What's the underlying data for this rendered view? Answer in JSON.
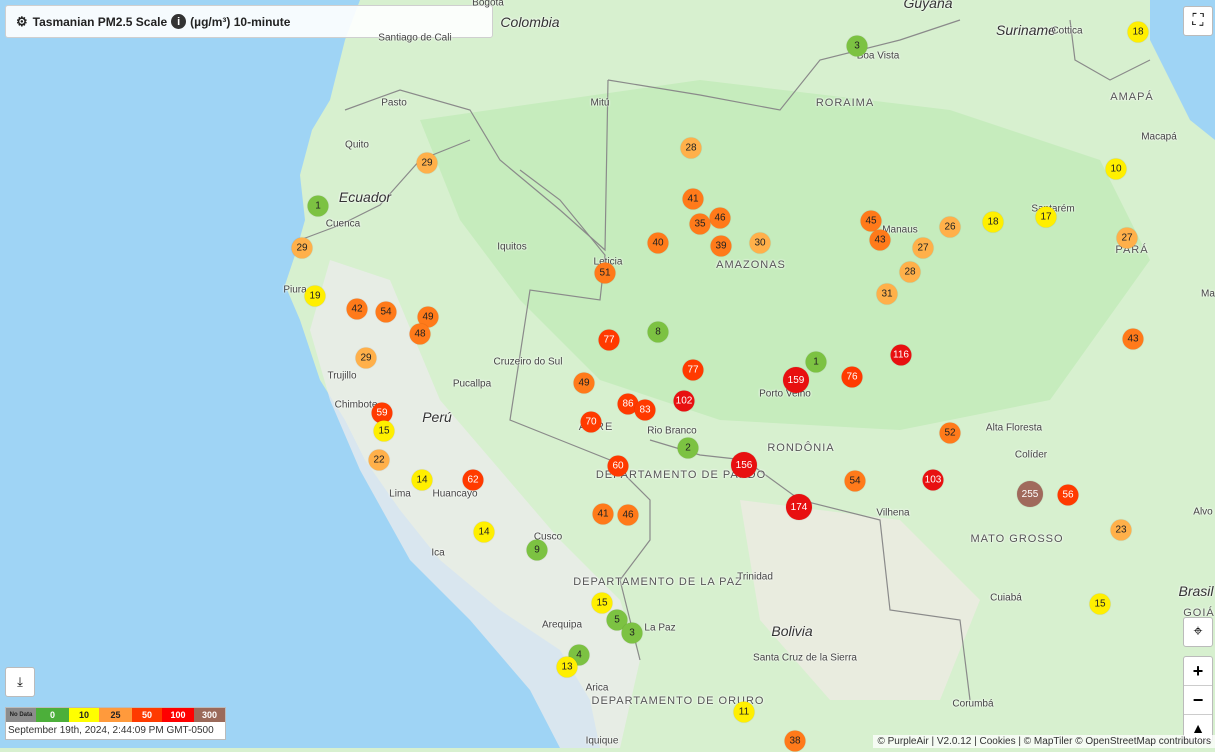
{
  "header": {
    "title": "Tasmanian PM2.5 Scale",
    "units": "(µg/m³) 10-minute",
    "settings_icon": "gear-icon",
    "info_icon": "info-icon"
  },
  "colors": {
    "water": "#9fd4f5",
    "land": "#d7f0cf",
    "dense_forest": "#bfe9b8",
    "andes": "#ececec",
    "border": "#8a8a8a"
  },
  "places": [
    {
      "name": "Colombia",
      "kind": "country"
    },
    {
      "name": "Ecuador",
      "kind": "country"
    },
    {
      "name": "Perú",
      "kind": "country"
    },
    {
      "name": "Bolivia",
      "kind": "country"
    },
    {
      "name": "Brasil",
      "kind": "country"
    },
    {
      "name": "Suriname",
      "kind": "country"
    },
    {
      "name": "Guyana",
      "kind": "country"
    },
    {
      "name": "RORAIMA",
      "kind": "region"
    },
    {
      "name": "AMAPÁ",
      "kind": "region"
    },
    {
      "name": "AMAZONAS",
      "kind": "region"
    },
    {
      "name": "PARÁ",
      "kind": "region"
    },
    {
      "name": "ACRE",
      "kind": "region"
    },
    {
      "name": "RONDÔNIA",
      "kind": "region"
    },
    {
      "name": "MATO GROSSO",
      "kind": "region"
    },
    {
      "name": "DEPARTAMENTO DE PANDO",
      "kind": "region"
    },
    {
      "name": "DEPARTAMENTO DE LA PAZ",
      "kind": "region"
    },
    {
      "name": "DEPARTAMENTO DE ORURO",
      "kind": "region"
    },
    {
      "name": "GOIÁ",
      "kind": "region"
    },
    {
      "name": "Bogota",
      "kind": "city"
    },
    {
      "name": "Santiago de Cali",
      "kind": "city"
    },
    {
      "name": "Pasto",
      "kind": "city"
    },
    {
      "name": "Mitú",
      "kind": "city"
    },
    {
      "name": "Boa Vista",
      "kind": "city"
    },
    {
      "name": "Cottica",
      "kind": "city"
    },
    {
      "name": "Macapá",
      "kind": "city"
    },
    {
      "name": "Quito",
      "kind": "city"
    },
    {
      "name": "Cuenca",
      "kind": "city"
    },
    {
      "name": "Iquitos",
      "kind": "city"
    },
    {
      "name": "Leticia",
      "kind": "city"
    },
    {
      "name": "Manaus",
      "kind": "city"
    },
    {
      "name": "Santarém",
      "kind": "city"
    },
    {
      "name": "Piura",
      "kind": "city"
    },
    {
      "name": "Cruzeiro do Sul",
      "kind": "city"
    },
    {
      "name": "Pucallpa",
      "kind": "city"
    },
    {
      "name": "Trujillo",
      "kind": "city"
    },
    {
      "name": "Chimbote",
      "kind": "city"
    },
    {
      "name": "Porto Velho",
      "kind": "city"
    },
    {
      "name": "Rio Branco",
      "kind": "city"
    },
    {
      "name": "Alta Floresta",
      "kind": "city"
    },
    {
      "name": "Colíder",
      "kind": "city"
    },
    {
      "name": "Huancayo",
      "kind": "city"
    },
    {
      "name": "Lima",
      "kind": "city"
    },
    {
      "name": "Vilhena",
      "kind": "city"
    },
    {
      "name": "Alvo",
      "kind": "city"
    },
    {
      "name": "Cusco",
      "kind": "city"
    },
    {
      "name": "Ica",
      "kind": "city"
    },
    {
      "name": "Trinidad",
      "kind": "city"
    },
    {
      "name": "Arequipa",
      "kind": "city"
    },
    {
      "name": "La Paz",
      "kind": "city"
    },
    {
      "name": "Cuiabá",
      "kind": "city"
    },
    {
      "name": "Santa Cruz de la Sierra",
      "kind": "city"
    },
    {
      "name": "Arica",
      "kind": "city"
    },
    {
      "name": "Iquique",
      "kind": "city"
    },
    {
      "name": "Corumbá",
      "kind": "city"
    },
    {
      "name": "Ma",
      "kind": "city"
    }
  ],
  "sensors": [
    {
      "value": "3"
    },
    {
      "value": "18"
    },
    {
      "value": "28"
    },
    {
      "value": "29"
    },
    {
      "value": "1"
    },
    {
      "value": "10"
    },
    {
      "value": "41"
    },
    {
      "value": "46"
    },
    {
      "value": "35"
    },
    {
      "value": "45"
    },
    {
      "value": "40"
    },
    {
      "value": "39"
    },
    {
      "value": "30"
    },
    {
      "value": "43"
    },
    {
      "value": "27"
    },
    {
      "value": "26"
    },
    {
      "value": "18"
    },
    {
      "value": "17"
    },
    {
      "value": "27"
    },
    {
      "value": "29"
    },
    {
      "value": "51"
    },
    {
      "value": "28"
    },
    {
      "value": "19"
    },
    {
      "value": "31"
    },
    {
      "value": "42"
    },
    {
      "value": "54"
    },
    {
      "value": "49"
    },
    {
      "value": "48"
    },
    {
      "value": "8"
    },
    {
      "value": "77"
    },
    {
      "value": "43"
    },
    {
      "value": "29"
    },
    {
      "value": "116"
    },
    {
      "value": "1"
    },
    {
      "value": "77"
    },
    {
      "value": "76"
    },
    {
      "value": "159"
    },
    {
      "value": "49"
    },
    {
      "value": "86"
    },
    {
      "value": "83"
    },
    {
      "value": "102"
    },
    {
      "value": "59"
    },
    {
      "value": "70"
    },
    {
      "value": "15"
    },
    {
      "value": "2"
    },
    {
      "value": "52"
    },
    {
      "value": "22"
    },
    {
      "value": "156"
    },
    {
      "value": "60"
    },
    {
      "value": "14"
    },
    {
      "value": "62"
    },
    {
      "value": "54"
    },
    {
      "value": "103"
    },
    {
      "value": "255"
    },
    {
      "value": "56"
    },
    {
      "value": "174"
    },
    {
      "value": "41"
    },
    {
      "value": "46"
    },
    {
      "value": "14"
    },
    {
      "value": "23"
    },
    {
      "value": "9"
    },
    {
      "value": "15"
    },
    {
      "value": "5"
    },
    {
      "value": "3"
    },
    {
      "value": "15"
    },
    {
      "value": "4"
    },
    {
      "value": "13"
    },
    {
      "value": "11"
    },
    {
      "value": "38"
    }
  ],
  "legend": {
    "labels": [
      "No Data",
      "0",
      "10",
      "25",
      "50",
      "100",
      "300"
    ],
    "colors": [
      "#8c8c8c",
      "#4caf3a",
      "#ffff00",
      "#ff9a3c",
      "#ff3b00",
      "#ff0000",
      "#9b6a5a"
    ],
    "timestamp": "September 19th, 2024, 2:44:09 PM GMT-0500"
  },
  "attribution": "© PurpleAir | V2.0.12 | Cookies | © MapTiler © OpenStreetMap contributors",
  "controls": {
    "zoom_in": "+",
    "zoom_out": "−",
    "fullscreen_icon": "fullscreen-icon",
    "locate_icon": "locate-icon",
    "compass_icon": "compass-icon",
    "download_icon": "download-icon"
  }
}
